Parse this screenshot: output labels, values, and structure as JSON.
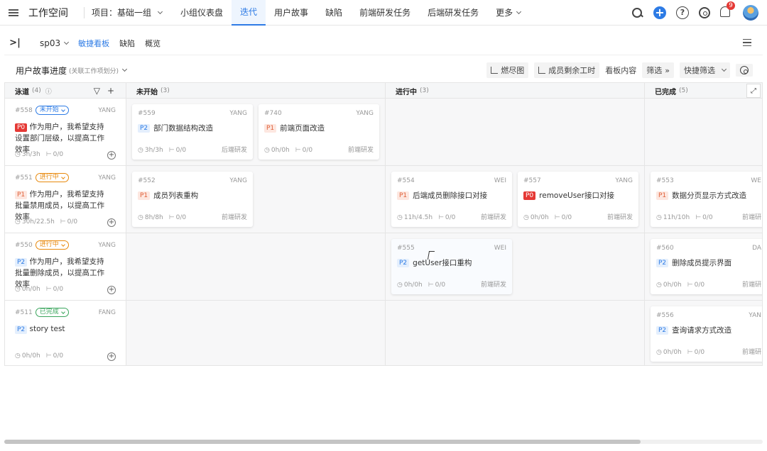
{
  "topbar": {
    "brand": "工作空间",
    "project": "项目：基础一组",
    "nav": [
      "小组仪表盘",
      "迭代",
      "用户故事",
      "缺陷",
      "前端研发任务",
      "后端研发任务",
      "更多"
    ],
    "active_nav": "迭代",
    "notification_count": "9",
    "accent": "#2d7be5"
  },
  "subbar": {
    "collapse_label": ">|",
    "sprint": "sp03",
    "tabs": [
      "敏捷看板",
      "缺陷",
      "概览"
    ]
  },
  "toolbar": {
    "title": "用户故事进度",
    "subtitle": "(关联工作项划分)",
    "burndown": "燃尽图",
    "member_hours": "成员剩余工时",
    "board_content": "看板内容",
    "filter": "筛选",
    "quick_filter": "快捷筛选"
  },
  "board": {
    "lane_header": {
      "label": "泳道",
      "count": "(4)"
    },
    "columns": [
      {
        "label": "未开始",
        "count": "(3)"
      },
      {
        "label": "进行中",
        "count": "(3)"
      },
      {
        "label": "已完成",
        "count": "(5)"
      }
    ],
    "lanes": [
      {
        "id": "#558",
        "status": "未开始",
        "owner": "YANG",
        "priority": "P0",
        "title": "作为用户，我希望支持设置部门层级，以提高工作效率",
        "hours": "3h/3h",
        "subtasks": "0/0",
        "cards": [
          {
            "id": "#559",
            "owner": "YANG",
            "priority": "P2",
            "title": "部门数据结构改造",
            "hours": "3h/3h",
            "subtasks": "0/0",
            "team": "后端研发"
          },
          {
            "id": "#740",
            "owner": "YANG",
            "priority": "P1",
            "title": "前端页面改造",
            "hours": "0h/0h",
            "subtasks": "0/0",
            "team": "前端研发"
          }
        ]
      },
      {
        "id": "#551",
        "status": "进行中",
        "owner": "YANG",
        "priority": "P1",
        "title": "作为用户，我希望支持批量禁用成员，以提高工作效率",
        "hours": "30h/22.5h",
        "subtasks": "0/0",
        "cards": [
          {
            "id": "#552",
            "owner": "YANG",
            "priority": "P1",
            "title": "成员列表重构",
            "hours": "8h/8h",
            "subtasks": "0/0",
            "team": "前端研发"
          },
          {
            "id": "#554",
            "owner": "WEI",
            "priority": "P1",
            "title": "后端成员删除接口对接",
            "hours": "11h/4.5h",
            "subtasks": "0/0",
            "team": "前端研发"
          },
          {
            "id": "#557",
            "owner": "YANG",
            "priority": "P0",
            "title": "removeUser接口对接",
            "hours": "0h/0h",
            "subtasks": "0/0",
            "team": "前端研发"
          },
          {
            "id": "#553",
            "owner": "WE",
            "priority": "P1",
            "title": "数据分页显示方式改造",
            "hours": "11h/10h",
            "subtasks": "0/0",
            "team": "前端研"
          }
        ]
      },
      {
        "id": "#550",
        "status": "进行中",
        "owner": "YANG",
        "priority": "P2",
        "title": "作为用户，我希望支持批量删除成员，以提高工作效率",
        "hours": "0h/0h",
        "subtasks": "0/0",
        "cards": [
          {
            "id": "#555",
            "owner": "WEI",
            "priority": "P2",
            "title": "getUser接口重构",
            "hours": "0h/0h",
            "subtasks": "0/0",
            "team": "前端研发"
          },
          {
            "id": "#560",
            "owner": "DA",
            "priority": "P2",
            "title": "删除成员提示界面",
            "hours": "0h/0h",
            "subtasks": "0/0",
            "team": "前端研"
          }
        ]
      },
      {
        "id": "#511",
        "status": "已完成",
        "owner": "FANG",
        "priority": "P2",
        "title": "story test",
        "hours": "0h/0h",
        "subtasks": "0/0",
        "cards": [
          {
            "id": "#556",
            "owner": "YAN",
            "priority": "P2",
            "title": "查询请求方式改造",
            "hours": "0h/0h",
            "subtasks": "0/0",
            "team": "前端研"
          }
        ]
      }
    ]
  }
}
